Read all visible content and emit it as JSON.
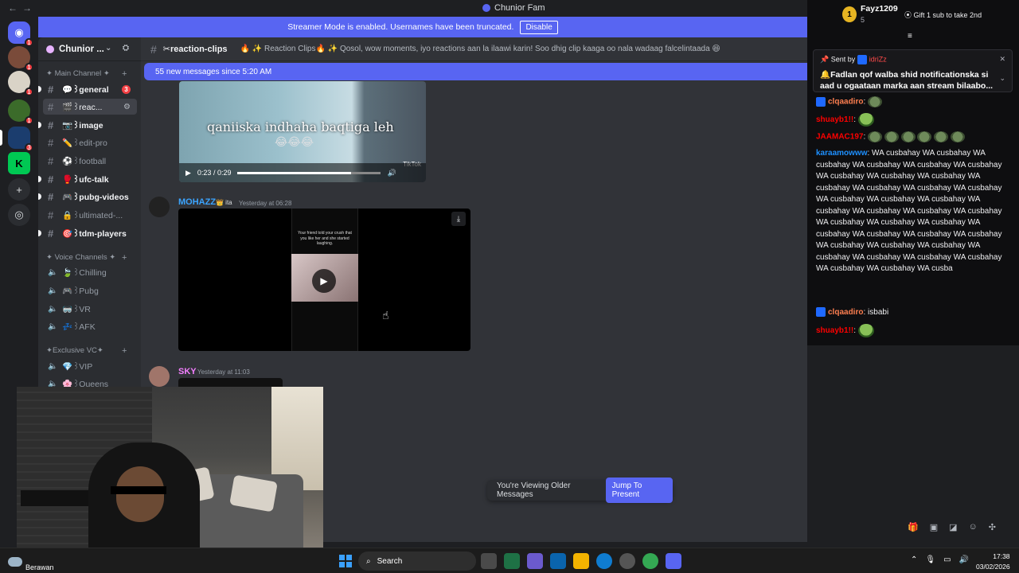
{
  "window": {
    "title": "Chunior Fam",
    "back": "←",
    "forward": "→"
  },
  "banner": {
    "text": "Streamer Mode is enabled. Usernames have been truncated.",
    "button": "Disable"
  },
  "server": {
    "name": "Chunior ...",
    "rail_badges": [
      "1",
      "1",
      "1",
      "1",
      "3"
    ]
  },
  "sidebar": {
    "categories": {
      "main": "✦ Main Channel ✦",
      "voice": "✦ Voice Channels ✦",
      "exclusive": "✦Exclusive VC✦"
    },
    "channels": [
      {
        "label": "💬꒱general",
        "badge": "3"
      },
      {
        "label": "🎬꒱reac..."
      },
      {
        "label": "📷꒱image"
      },
      {
        "label": "✏️꒱edit-pro"
      },
      {
        "label": "⚽꒱football"
      },
      {
        "label": "🥊꒱ufc-talk"
      },
      {
        "label": "🎮꒱pubg-videos"
      },
      {
        "label": "🔒꒱ultimated-..."
      },
      {
        "label": "🎯꒱tdm-players"
      }
    ],
    "voice": [
      {
        "label": "🍃꒱Chilling"
      },
      {
        "label": "🎮꒱Pubg"
      },
      {
        "label": "🥽꒱VR"
      },
      {
        "label": "💤꒱AFK"
      }
    ],
    "exclusive": [
      {
        "label": "💎꒱VIP"
      },
      {
        "label": "🌸꒱Queens"
      }
    ]
  },
  "chat": {
    "channel": "✂reaction-clips",
    "topic": "🔥 ✨ Reaction Clips🔥 ✨ Qosol, wow moments, iyo reactions aan la ilaawi karin! Soo dhig clip kaaga oo nala wadaag falcelintaada 😆",
    "new_messages": "55 new messages since 5:20 AM",
    "video1": {
      "caption": "qaniiska indhaha baqtiga leh",
      "emoji": "😂😂😂",
      "time": "0:23 / 0:29",
      "progress": 0.79,
      "watermark": "TikTok"
    },
    "messages": [
      {
        "author": "MOHAZZ",
        "tag": "👑 ita",
        "time": "Yesterday at 06:28",
        "color": "#3ba4ff"
      },
      {
        "author": "SKY",
        "time": "Yesterday at 11:03",
        "color": "#f47fff"
      }
    ],
    "video2": {
      "phone_text": "Your friend told your crush that you like her and she started laughing."
    },
    "older": {
      "text": "You're Viewing Older Messages",
      "jump": "Jump To Present"
    }
  },
  "stream_chat": {
    "gifter": {
      "name": "Fayz1209",
      "rank": "1",
      "count": "5",
      "gift_text": "Gift 1 sub to take 2nd"
    },
    "pinned": {
      "sent_by": "Sent by",
      "sender": "idriZz",
      "text": "🔔Fadlan qof walba shid notificationska si aad u ogaataan marka aan stream bilaabo..."
    },
    "lines": [
      {
        "user": "clqaadiro",
        "text": "",
        "color": "#ff7f50",
        "emote": "tiny"
      },
      {
        "user": "shuayb1!!",
        "text": "",
        "color": "#ff0000",
        "emote": "frog"
      },
      {
        "user": "JAAMAC197",
        "text": "",
        "color": "#ff0000",
        "emote": "frogs"
      },
      {
        "user": "karaamowww",
        "text": "WA cusbahay WA cusbahay WA cusbahay WA cusbahay WA cusbahay WA cusbahay WA cusbahay WA cusbahay WA cusbahay WA cusbahay WA cusbahay WA cusbahay WA cusbahay WA cusbahay WA cusbahay WA cusbahay WA cusbahay WA cusbahay WA cusbahay WA cusbahay WA cusbahay WA cusbahay WA cusbahay WA cusbahay WA cusbahay WA cusbahay WA cusbahay WA cusbahay WA cusbahay WA cusbahay WA cusbahay WA cusbahay WA cusbahay WA cusbahay WA cusbahay WA cusbahay WA cusba",
        "color": "#1e90ff"
      },
      {
        "user": "clqaadiro",
        "text": "isbabi",
        "color": "#ff7f50"
      },
      {
        "user": "shuayb1!!",
        "text": "",
        "color": "#ff0000",
        "emote": "frog"
      }
    ]
  },
  "taskbar": {
    "weather": "Berawan",
    "search": "Search",
    "time": "17:38",
    "date": "03/02/2026"
  }
}
